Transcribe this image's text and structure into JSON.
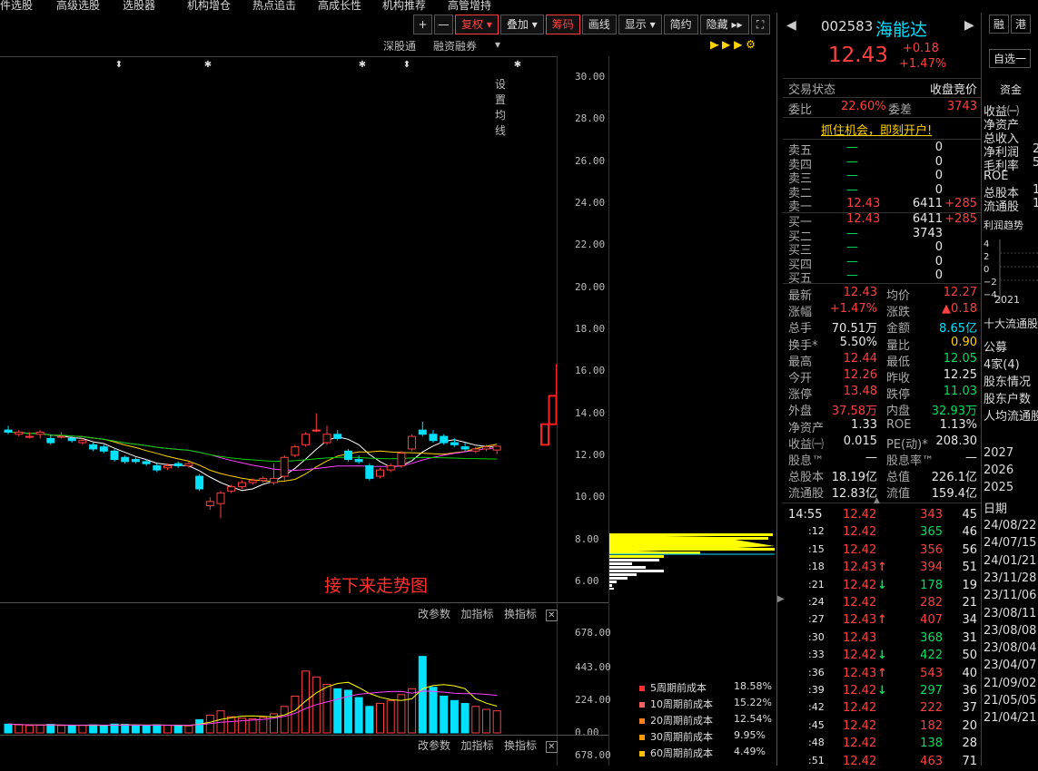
{
  "top_menu": [
    "件选股",
    "高级选股",
    "选股器",
    "机构增仓",
    "热点追击",
    "高成长性",
    "机构推荐",
    "高管增持"
  ],
  "toolbar": {
    "plus": "+",
    "minus": "—",
    "fuquan": "复权",
    "diejia": "叠加",
    "chouma": "筹码",
    "huaxian": "画线",
    "xianshi": "显示",
    "jianyue": "简约",
    "yincang": "隐藏"
  },
  "sub_tabs": [
    "深股通",
    "融资融券",
    "设置均线"
  ],
  "annotation": "接下来走势图",
  "y_axis_labels": [
    "30.00",
    "28.00",
    "26.00",
    "24.00",
    "22.00",
    "20.00",
    "18.00",
    "16.00",
    "14.00",
    "12.00",
    "10.00",
    "8.00",
    "6.00"
  ],
  "vol_axis_labels": [
    "678.00",
    "443.00",
    "224.00",
    "0.00"
  ],
  "vol2_axis_label": "678.00",
  "indicator_controls": [
    "改参数",
    "加指标",
    "换指标"
  ],
  "legend": [
    {
      "label": "5周期前成本",
      "pct": "18.58%",
      "color": "#ff3030"
    },
    {
      "label": "10周期前成本",
      "pct": "15.22%",
      "color": "#ff6060"
    },
    {
      "label": "20周期前成本",
      "pct": "12.54%",
      "color": "#ff8020"
    },
    {
      "label": "30周期前成本",
      "pct": "9.95%",
      "color": "#ff9a00"
    },
    {
      "label": "60周期前成本",
      "pct": "4.49%",
      "color": "#ffc000"
    }
  ],
  "quote": {
    "code": "002583",
    "name": "海能达",
    "price": "12.43",
    "change": "+0.18",
    "change_pct": "+1.47%",
    "btn_rong": "融",
    "btn_gang": "港",
    "zixuan": "自选一"
  },
  "trade_state": {
    "label": "交易状态",
    "value": "收盘竞价"
  },
  "weibi": {
    "label": "委比",
    "value": "22.60%",
    "label2": "委差",
    "value2": "3743"
  },
  "banner": "抓住机会，即刻开户!",
  "sell_levels": [
    {
      "label": "卖五",
      "price": "—",
      "vol": "0",
      "chg": ""
    },
    {
      "label": "卖四",
      "price": "—",
      "vol": "0",
      "chg": ""
    },
    {
      "label": "卖三",
      "price": "—",
      "vol": "0",
      "chg": ""
    },
    {
      "label": "卖二",
      "price": "—",
      "vol": "0",
      "chg": ""
    },
    {
      "label": "卖一",
      "price": "12.43",
      "vol": "6411",
      "chg": "+285"
    }
  ],
  "buy_levels": [
    {
      "label": "买一",
      "price": "12.43",
      "vol": "6411",
      "chg": "+285"
    },
    {
      "label": "买二",
      "price": "—",
      "vol": "3743",
      "chg": ""
    },
    {
      "label": "买三",
      "price": "—",
      "vol": "0",
      "chg": ""
    },
    {
      "label": "买四",
      "price": "—",
      "vol": "0",
      "chg": ""
    },
    {
      "label": "买五",
      "price": "—",
      "vol": "0",
      "chg": ""
    }
  ],
  "stats": [
    {
      "l1": "最新",
      "v1": "12.43",
      "c1": "red",
      "l2": "均价",
      "v2": "12.27",
      "c2": "red"
    },
    {
      "l1": "涨幅",
      "v1": "+1.47%",
      "c1": "red",
      "l2": "涨跌",
      "v2": "▲0.18",
      "c2": "red"
    },
    {
      "l1": "总手",
      "v1": "70.51万",
      "c1": "white",
      "l2": "金额",
      "v2": "8.65亿",
      "c2": "cyan"
    },
    {
      "l1": "换手*",
      "v1": "5.50%",
      "c1": "white",
      "l2": "量比",
      "v2": "0.90",
      "c2": "yellow"
    },
    {
      "l1": "最高",
      "v1": "12.44",
      "c1": "red",
      "l2": "最低",
      "v2": "12.05",
      "c2": "green"
    },
    {
      "l1": "今开",
      "v1": "12.26",
      "c1": "red",
      "l2": "昨收",
      "v2": "12.25",
      "c2": "white"
    },
    {
      "l1": "涨停",
      "v1": "13.48",
      "c1": "red",
      "l2": "跌停",
      "v2": "11.03",
      "c2": "green"
    },
    {
      "l1": "外盘",
      "v1": "37.58万",
      "c1": "red",
      "l2": "内盘",
      "v2": "32.93万",
      "c2": "green"
    },
    {
      "l1": "净资产",
      "v1": "1.33",
      "c1": "white",
      "l2": "ROE",
      "v2": "1.13%",
      "c2": "white"
    },
    {
      "l1": "收益㈠",
      "v1": "0.015",
      "c1": "white",
      "l2": "PE(动)*",
      "v2": "208.30",
      "c2": "white"
    },
    {
      "l1": "股息™",
      "v1": "—",
      "c1": "white",
      "l2": "股息率™",
      "v2": "—",
      "c2": "white"
    },
    {
      "l1": "总股本",
      "v1": "18.19亿",
      "c1": "white",
      "l2": "总值",
      "v2": "226.1亿",
      "c2": "white"
    },
    {
      "l1": "流通股",
      "v1": "12.83亿",
      "c1": "white",
      "l2": "流值",
      "v2": "159.4亿",
      "c2": "white"
    }
  ],
  "ticks": [
    {
      "t": "14:55",
      "p": "12.42",
      "a": "",
      "v": "343",
      "n": "45"
    },
    {
      "t": ":12",
      "p": "12.42",
      "a": "",
      "v": "365",
      "n": "46"
    },
    {
      "t": ":15",
      "p": "12.42",
      "a": "",
      "v": "356",
      "n": "56"
    },
    {
      "t": ":18",
      "p": "12.43",
      "a": "↑",
      "v": "394",
      "n": "51"
    },
    {
      "t": ":21",
      "p": "12.42",
      "a": "↓",
      "v": "178",
      "n": "19"
    },
    {
      "t": ":24",
      "p": "12.42",
      "a": "",
      "v": "282",
      "n": "21"
    },
    {
      "t": ":27",
      "p": "12.43",
      "a": "↑",
      "v": "407",
      "n": "34"
    },
    {
      "t": ":30",
      "p": "12.43",
      "a": "",
      "v": "368",
      "n": "31"
    },
    {
      "t": ":33",
      "p": "12.42",
      "a": "↓",
      "v": "422",
      "n": "50"
    },
    {
      "t": ":36",
      "p": "12.43",
      "a": "↑",
      "v": "543",
      "n": "40"
    },
    {
      "t": ":39",
      "p": "12.42",
      "a": "↓",
      "v": "297",
      "n": "36"
    },
    {
      "t": ":42",
      "p": "12.42",
      "a": "",
      "v": "222",
      "n": "37"
    },
    {
      "t": ":45",
      "p": "12.42",
      "a": "",
      "v": "182",
      "n": "20"
    },
    {
      "t": ":48",
      "p": "12.42",
      "a": "",
      "v": "138",
      "n": "28"
    },
    {
      "t": ":51",
      "p": "12.42",
      "a": "",
      "v": "463",
      "n": "71"
    }
  ],
  "far_right": {
    "tab": "资金",
    "items_top": [
      "收益㈠",
      "净资产",
      "总收入",
      "净利润",
      "毛利率",
      "ROE",
      "总股本",
      "流通股"
    ],
    "vals_top": [
      "",
      "",
      "",
      "2",
      "5",
      "",
      "1",
      "1"
    ],
    "trend_title": "利润趋势",
    "trend_year": "2021",
    "trend_axis": [
      "4",
      "2",
      "0",
      "−2",
      "−4"
    ],
    "holders": "十大流通股",
    "holder_items": [
      "公募",
      "4家(4)",
      "股东情况",
      "股东户数",
      "人均流通股"
    ],
    "years": [
      "2027",
      "2026",
      "2025"
    ],
    "date_label": "日期",
    "dates": [
      "24/08/22",
      "24/07/15",
      "24/01/21",
      "23/11/28",
      "23/11/06",
      "23/08/11",
      "23/08/08",
      "23/08/04",
      "23/04/07",
      "21/09/02",
      "21/05/05",
      "21/04/21"
    ]
  },
  "colors": {
    "up": "#ff4040",
    "down": "#00e0ff",
    "ma5": "#ffffff",
    "ma10": "#ffd400",
    "ma20": "#ff40ff",
    "ma60": "#00d000"
  },
  "chart_data": {
    "type": "candlestick",
    "ylim": [
      5,
      31
    ],
    "candles": [
      [
        13.2,
        13.4,
        13.0,
        13.1
      ],
      [
        13.0,
        13.2,
        12.9,
        13.1
      ],
      [
        12.9,
        13.1,
        12.8,
        12.9
      ],
      [
        13.0,
        13.2,
        12.8,
        13.1
      ],
      [
        12.8,
        13.0,
        12.5,
        12.6
      ],
      [
        12.9,
        13.1,
        12.8,
        12.9
      ],
      [
        12.8,
        12.9,
        12.6,
        12.7
      ],
      [
        12.6,
        12.8,
        12.5,
        12.7
      ],
      [
        12.5,
        12.6,
        12.2,
        12.3
      ],
      [
        12.4,
        12.5,
        12.1,
        12.2
      ],
      [
        12.2,
        12.3,
        11.7,
        11.8
      ],
      [
        11.9,
        12.0,
        11.6,
        11.7
      ],
      [
        11.8,
        11.9,
        11.6,
        11.7
      ],
      [
        11.7,
        11.8,
        11.5,
        11.6
      ],
      [
        11.5,
        11.6,
        11.2,
        11.3
      ],
      [
        11.4,
        11.6,
        11.3,
        11.5
      ],
      [
        11.6,
        11.7,
        11.4,
        11.5
      ],
      [
        11.5,
        11.7,
        11.4,
        11.6
      ],
      [
        11.0,
        11.1,
        10.3,
        10.4
      ],
      [
        9.6,
        10.0,
        9.4,
        9.8
      ],
      [
        9.7,
        10.3,
        9.0,
        10.2
      ],
      [
        10.3,
        10.6,
        10.2,
        10.5
      ],
      [
        10.5,
        10.8,
        10.4,
        10.7
      ],
      [
        10.7,
        10.9,
        10.6,
        10.8
      ],
      [
        10.8,
        11.0,
        10.7,
        10.9
      ],
      [
        10.7,
        11.6,
        10.6,
        10.9
      ],
      [
        11.0,
        12.0,
        10.8,
        11.9
      ],
      [
        12.0,
        12.5,
        11.9,
        12.4
      ],
      [
        12.5,
        13.1,
        12.4,
        13.0
      ],
      [
        13.2,
        14.0,
        13.1,
        13.2
      ],
      [
        12.6,
        13.4,
        12.5,
        13.0
      ],
      [
        13.0,
        13.2,
        12.7,
        12.8
      ],
      [
        12.2,
        12.3,
        11.7,
        11.8
      ],
      [
        11.8,
        12.0,
        11.6,
        11.7
      ],
      [
        11.5,
        11.6,
        10.8,
        10.9
      ],
      [
        11.0,
        11.4,
        10.9,
        11.3
      ],
      [
        11.3,
        11.6,
        11.2,
        11.5
      ],
      [
        11.5,
        12.2,
        11.4,
        12.1
      ],
      [
        12.3,
        13.0,
        12.2,
        12.9
      ],
      [
        13.2,
        13.6,
        12.9,
        13.0
      ],
      [
        13.0,
        13.2,
        12.6,
        12.7
      ],
      [
        12.9,
        13.0,
        12.5,
        12.6
      ],
      [
        12.6,
        12.8,
        12.4,
        12.5
      ],
      [
        12.4,
        12.6,
        12.2,
        12.3
      ],
      [
        12.2,
        12.4,
        12.1,
        12.3
      ],
      [
        12.3,
        12.5,
        12.2,
        12.4
      ],
      [
        12.25,
        12.44,
        12.05,
        12.43
      ],
      [
        12.5,
        13.48,
        12.5,
        13.48
      ],
      [
        13.48,
        14.83,
        13.48,
        14.83
      ],
      [
        14.83,
        16.31,
        14.83,
        16.31
      ],
      [
        16.31,
        17.94,
        16.31,
        17.94
      ],
      [
        17.94,
        19.73,
        17.94,
        19.73
      ],
      [
        19.73,
        21.7,
        19.73,
        21.7
      ]
    ],
    "volumes": [
      60,
      55,
      50,
      52,
      58,
      50,
      48,
      52,
      55,
      50,
      60,
      58,
      50,
      48,
      55,
      52,
      50,
      48,
      90,
      120,
      150,
      110,
      100,
      95,
      105,
      130,
      180,
      250,
      420,
      380,
      330,
      300,
      290,
      240,
      180,
      200,
      220,
      260,
      300,
      520,
      310,
      250,
      220,
      200,
      180,
      160,
      150
    ]
  }
}
